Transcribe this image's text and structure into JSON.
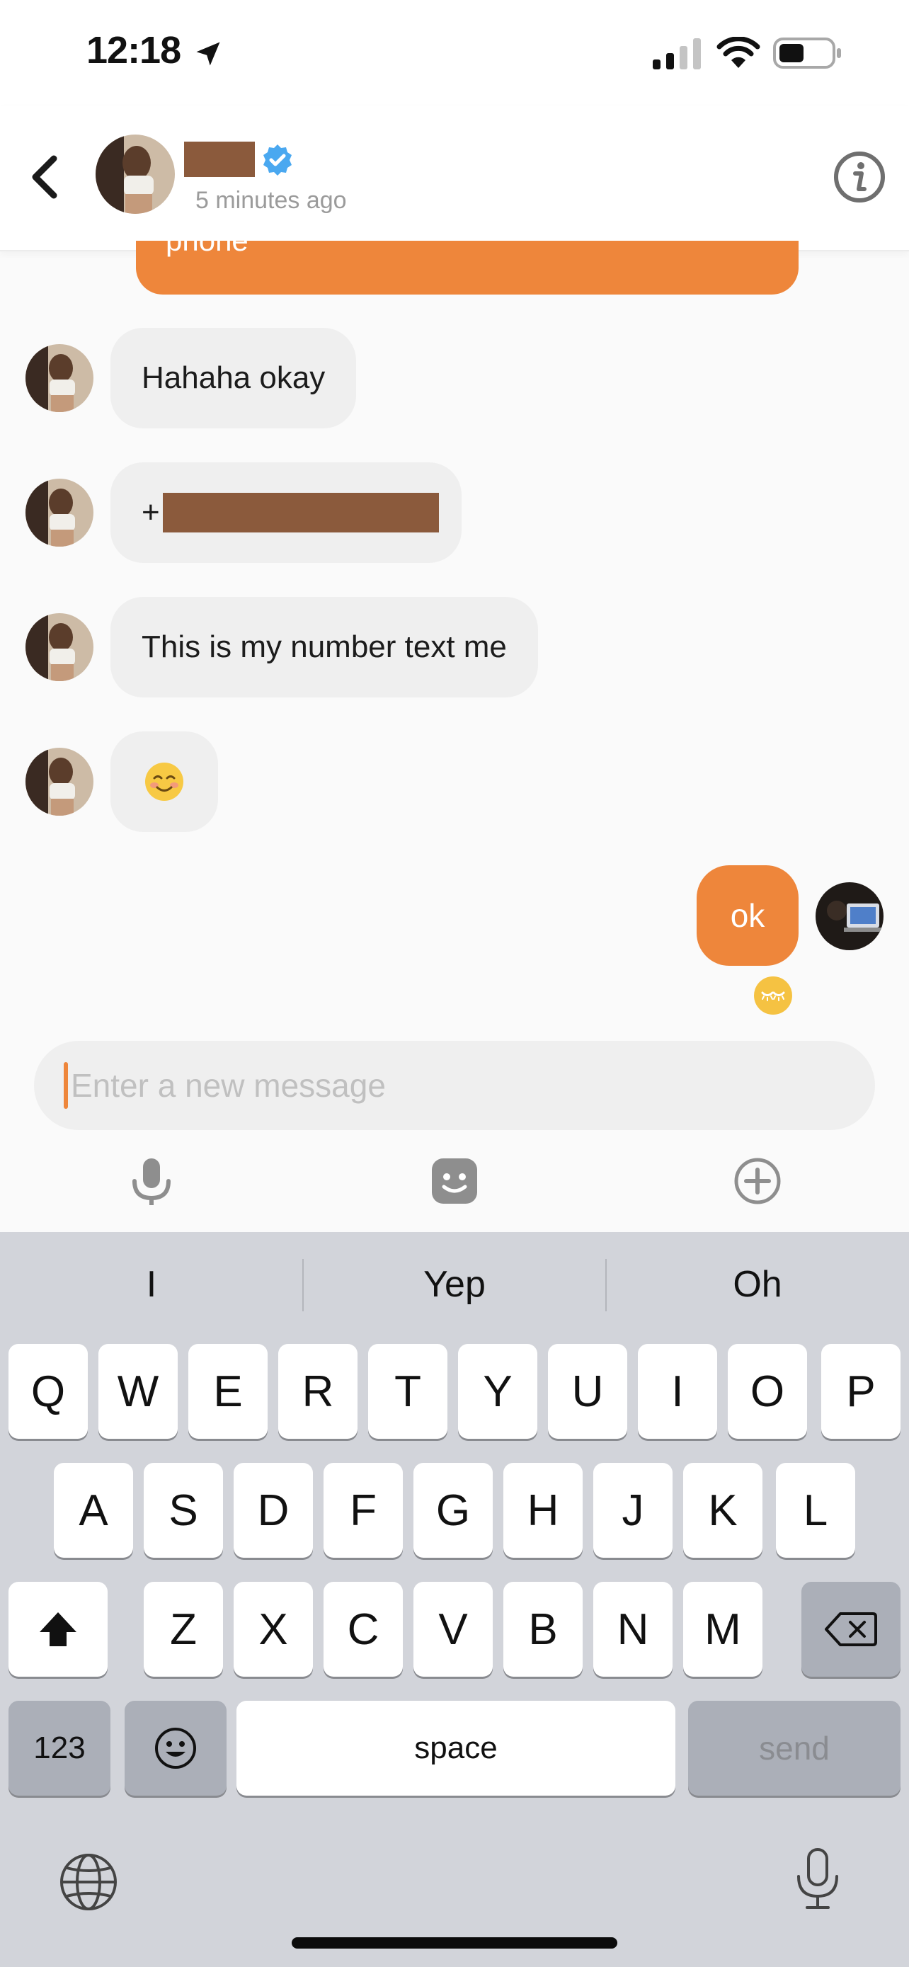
{
  "status_bar": {
    "time": "12:18"
  },
  "header": {
    "last_seen": "5 minutes ago"
  },
  "messages": {
    "partial_out_text": "phone",
    "incoming": [
      {
        "type": "text",
        "text": "Hahaha okay"
      },
      {
        "type": "phone",
        "prefix": "+"
      },
      {
        "type": "text",
        "text": "This is my number text me"
      },
      {
        "type": "emoji",
        "text": "☺️"
      }
    ],
    "outgoing_text": "ok"
  },
  "composer": {
    "placeholder": "Enter a new message"
  },
  "keyboard": {
    "suggestions": [
      "I",
      "Yep",
      "Oh"
    ],
    "row1": [
      "Q",
      "W",
      "E",
      "R",
      "T",
      "Y",
      "U",
      "I",
      "O",
      "P"
    ],
    "row2": [
      "A",
      "S",
      "D",
      "F",
      "G",
      "H",
      "J",
      "K",
      "L"
    ],
    "row3": [
      "Z",
      "X",
      "C",
      "V",
      "B",
      "N",
      "M"
    ],
    "numbers_key": "123",
    "space_key": "space",
    "send_key": "send"
  },
  "colors": {
    "accent": "#ee863b",
    "incoming_bubble": "#efefef",
    "keyboard_bg": "#d2d4da",
    "redaction": "#8b5a3c",
    "verified": "#4aa8f0"
  }
}
